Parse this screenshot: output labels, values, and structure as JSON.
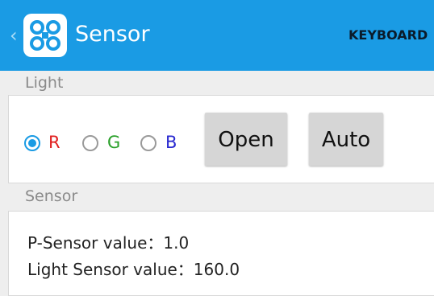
{
  "appbar": {
    "title": "Sensor",
    "logo_icon": "app-logo-icon",
    "back_icon": "chevron-left-icon",
    "action_label": "KEYBOARD",
    "color": "#1a9be4"
  },
  "light_section": {
    "header": "Light",
    "radios": [
      {
        "label": "R",
        "color": "#e02020",
        "checked": true
      },
      {
        "label": "G",
        "color": "#2aa02a",
        "checked": false
      },
      {
        "label": "B",
        "color": "#2a2ad0",
        "checked": false
      }
    ],
    "open_button": "Open",
    "auto_button": "Auto"
  },
  "sensor_section": {
    "header": "Sensor",
    "p_sensor": "P-Sensor value：1.0",
    "light_sensor": "Light Sensor value：160.0"
  }
}
